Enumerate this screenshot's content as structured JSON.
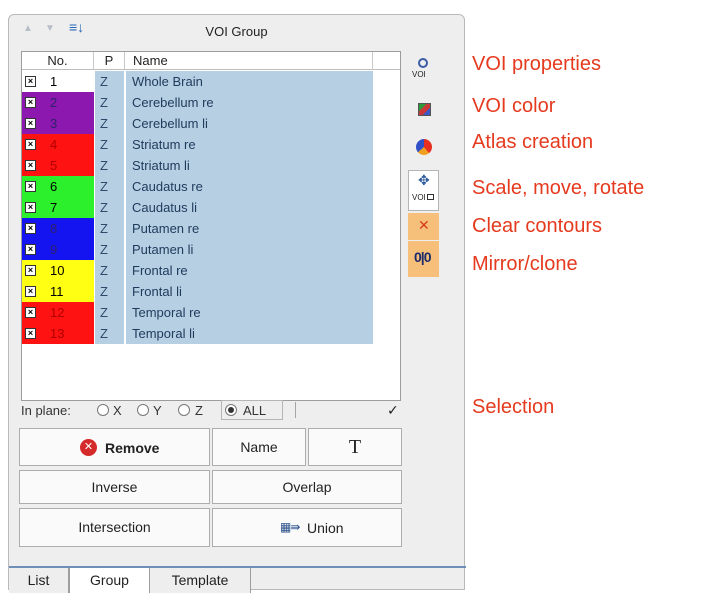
{
  "panel": {
    "title": "VOI Group",
    "sort_icon": "sort-list-icon"
  },
  "table": {
    "headers": [
      "No.",
      "P",
      "Name"
    ],
    "rows": [
      {
        "no": "1",
        "plane": "Z",
        "name": "Whole Brain",
        "color": "#ffffff",
        "checked": true
      },
      {
        "no": "2",
        "plane": "Z",
        "name": "Cerebellum re",
        "color": "#8c18b0",
        "checked": true
      },
      {
        "no": "3",
        "plane": "Z",
        "name": "Cerebellum li",
        "color": "#8c18b0",
        "checked": true
      },
      {
        "no": "4",
        "plane": "Z",
        "name": "Striatum re",
        "color": "#ff1212",
        "checked": true
      },
      {
        "no": "5",
        "plane": "Z",
        "name": "Striatum li",
        "color": "#ff1212",
        "checked": true
      },
      {
        "no": "6",
        "plane": "Z",
        "name": "Caudatus re",
        "color": "#2cf02c",
        "checked": true
      },
      {
        "no": "7",
        "plane": "Z",
        "name": "Caudatus li",
        "color": "#2cf02c",
        "checked": true
      },
      {
        "no": "8",
        "plane": "Z",
        "name": "Putamen re",
        "color": "#1414f0",
        "checked": true
      },
      {
        "no": "9",
        "plane": "Z",
        "name": "Putamen li",
        "color": "#1414f0",
        "checked": true
      },
      {
        "no": "10",
        "plane": "Z",
        "name": "Frontal re",
        "color": "#ffff14",
        "checked": true
      },
      {
        "no": "11",
        "plane": "Z",
        "name": "Frontal li",
        "color": "#ffff14",
        "checked": true
      },
      {
        "no": "12",
        "plane": "Z",
        "name": "Temporal re",
        "color": "#ff1212",
        "checked": true
      },
      {
        "no": "13",
        "plane": "Z",
        "name": "Temporal li",
        "color": "#ff1212",
        "checked": true
      }
    ]
  },
  "inplane": {
    "label": "In plane:",
    "options": [
      "X",
      "Y",
      "Z",
      "ALL"
    ],
    "selected": "ALL",
    "confirm_icon": "checkmark-icon"
  },
  "buttons": {
    "remove": "Remove",
    "name": "Name",
    "text_tool": "T",
    "inverse": "Inverse",
    "overlap": "Overlap",
    "intersection": "Intersection",
    "union": "Union"
  },
  "side_tools": {
    "properties_icon": "voi-properties-icon",
    "properties_sub": "VOI",
    "color_icon": "voi-color-icon",
    "atlas_icon": "atlas-creation-icon",
    "transform_icon": "scale-move-rotate-icon",
    "transform_sub": "VOI",
    "clear_icon": "clear-contours-icon",
    "mirror_icon": "mirror-clone-icon"
  },
  "tabs": [
    "List",
    "Group",
    "Template"
  ],
  "active_tab": "Group",
  "annotations": {
    "voi_properties": "VOI properties",
    "voi_color": "VOI color",
    "atlas_creation": "Atlas creation",
    "scale_move_rotate": "Scale, move, rotate",
    "clear_contours": "Clear contours",
    "mirror_clone": "Mirror/clone",
    "selection": "Selection"
  },
  "colors": {
    "annotation": "#e53a1e",
    "selection_row": "#b6cfe3",
    "remove_icon": "#d42a2a",
    "tab_accent": "#6d8fb8"
  }
}
